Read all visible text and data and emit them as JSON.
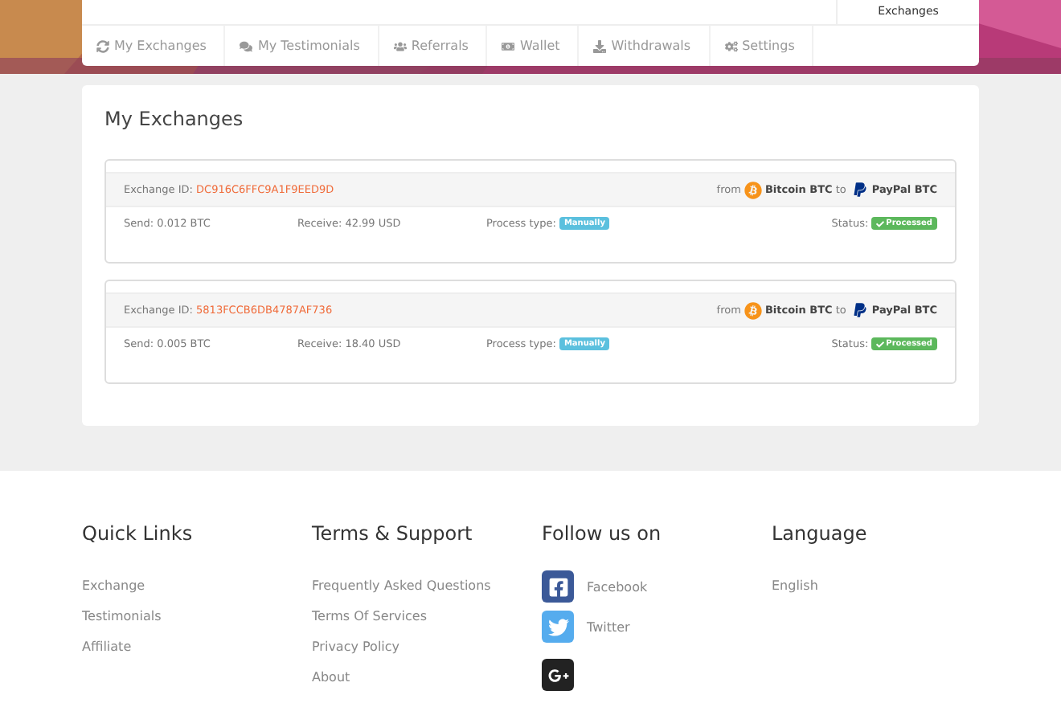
{
  "header": {
    "account_tab": "Exchanges"
  },
  "nav": [
    {
      "label": "My Exchanges",
      "selected": false
    },
    {
      "label": "My Testimonials",
      "selected": false
    },
    {
      "label": "Referrals",
      "selected": false
    },
    {
      "label": "Wallet",
      "selected": false
    },
    {
      "label": "Withdrawals",
      "selected": false
    },
    {
      "label": "Settings",
      "selected": false
    }
  ],
  "panel": {
    "title": "My Exchanges"
  },
  "exchanges": [
    {
      "id_label": "Exchange ID:",
      "id": "DC916C6FFC9A1F9EED9D",
      "from_word": "from",
      "from": "Bitcoin BTC",
      "to_word": "to",
      "to": "PayPal BTC",
      "send": "Send: 0.012 BTC",
      "receive": "Receive: 42.99 USD",
      "process_label": "Process type:",
      "process": "Manually",
      "status_label": "Status:",
      "status": "Processed"
    },
    {
      "id_label": "Exchange ID:",
      "id": "5813FCCB6DB4787AF736",
      "from_word": "from",
      "from": "Bitcoin BTC",
      "to_word": "to",
      "to": "PayPal BTC",
      "send": "Send: 0.005 BTC",
      "receive": "Receive: 18.40 USD",
      "process_label": "Process type:",
      "process": "Manually",
      "status_label": "Status:",
      "status": "Processed"
    }
  ],
  "footer": [
    {
      "title": "Quick Links",
      "kind": "links",
      "items": [
        {
          "label": "Exchange"
        },
        {
          "label": "Testimonials"
        },
        {
          "label": "Affiliate"
        }
      ]
    },
    {
      "title": "Terms & Support",
      "kind": "links",
      "items": [
        {
          "label": "Frequently Asked Questions"
        },
        {
          "label": "Terms Of Services"
        },
        {
          "label": "Privacy Policy"
        },
        {
          "label": "About"
        }
      ]
    },
    {
      "title": "Follow us on",
      "kind": "social",
      "items": [
        {
          "label": "Facebook"
        },
        {
          "label": "Twitter"
        }
      ]
    },
    {
      "title": "Language",
      "kind": "links",
      "items": [
        {
          "label": "English"
        }
      ]
    }
  ]
}
